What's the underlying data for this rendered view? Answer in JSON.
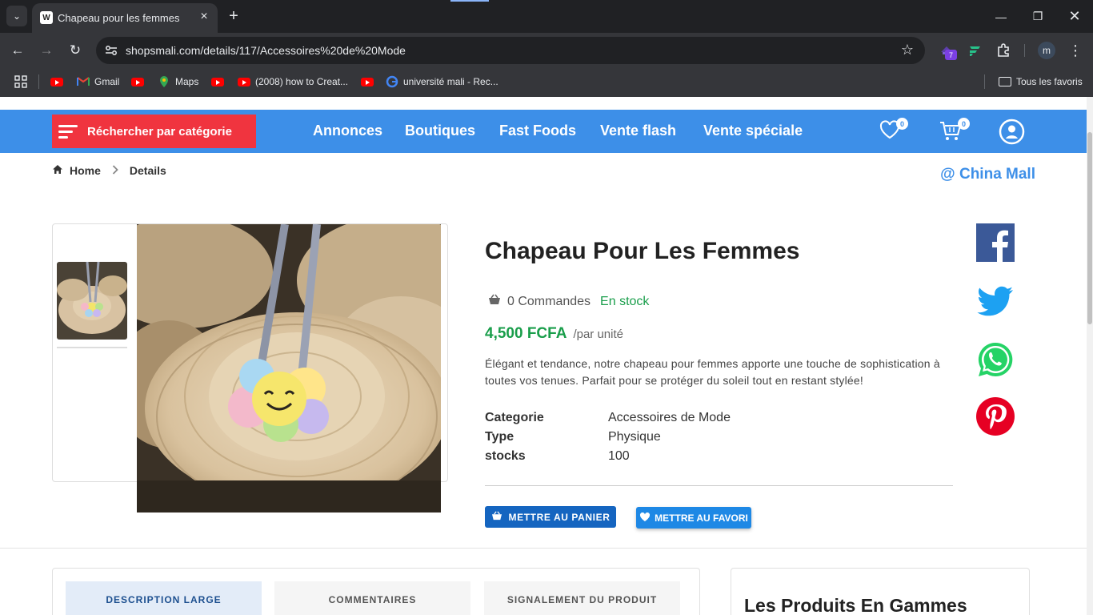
{
  "browser": {
    "tab_title": "Chapeau pour les femmes",
    "url": "shopsmali.com/details/117/Accessoires%20de%20Mode",
    "extension_badge": "7",
    "profile_initial": "m",
    "bookmarks": [
      {
        "label": "",
        "icon": "youtube-icon"
      },
      {
        "label": "Gmail",
        "icon": "gmail-icon"
      },
      {
        "label": "",
        "icon": "youtube-icon"
      },
      {
        "label": "Maps",
        "icon": "maps-icon"
      },
      {
        "label": "",
        "icon": "youtube-icon"
      },
      {
        "label": "(2008) how to Creat...",
        "icon": "youtube-icon"
      },
      {
        "label": "",
        "icon": "youtube-icon"
      },
      {
        "label": "université mali - Rec...",
        "icon": "google-icon"
      }
    ],
    "all_bookmarks": "Tous les favoris"
  },
  "nav": {
    "category_button": "Réchercher par catégorie",
    "links": [
      "Annonces",
      "Boutiques",
      "Fast Foods",
      "Vente flash",
      "Vente spéciale"
    ],
    "wishlist_count": "0",
    "cart_count": "0"
  },
  "breadcrumb": {
    "home": "Home",
    "current": "Details"
  },
  "shop_name": "@ China Mall",
  "product": {
    "title": "Chapeau Pour Les Femmes",
    "orders": "0 Commandes",
    "stock_status": "En stock",
    "price": "4,500 FCFA",
    "unit": "/par unité",
    "description": "Élégant et tendance, notre chapeau pour femmes apporte une touche de sophistication à toutes vos tenues. Parfait pour se protéger du soleil tout en restant stylée!",
    "specs": [
      {
        "key": "Categorie",
        "value": "Accessoires de Mode"
      },
      {
        "key": "Type",
        "value": "Physique"
      },
      {
        "key": "stocks",
        "value": "100"
      }
    ],
    "add_to_cart": "METTRE AU PANIER",
    "add_to_favorites": "METTRE AU FAVORI"
  },
  "social": [
    "facebook-icon",
    "twitter-icon",
    "whatsapp-icon",
    "pinterest-icon"
  ],
  "tabs": [
    "DESCRIPTION LARGE",
    "COMMENTAIRES",
    "SIGNALEMENT DU PRODUIT"
  ],
  "related_title": "Les Produits En Gammes",
  "colors": {
    "nav_blue": "#3d8fe8",
    "category_red": "#f0343f",
    "price_green": "#1a9e4b",
    "cart_button": "#1565c0",
    "fav_button": "#1e88e5"
  }
}
